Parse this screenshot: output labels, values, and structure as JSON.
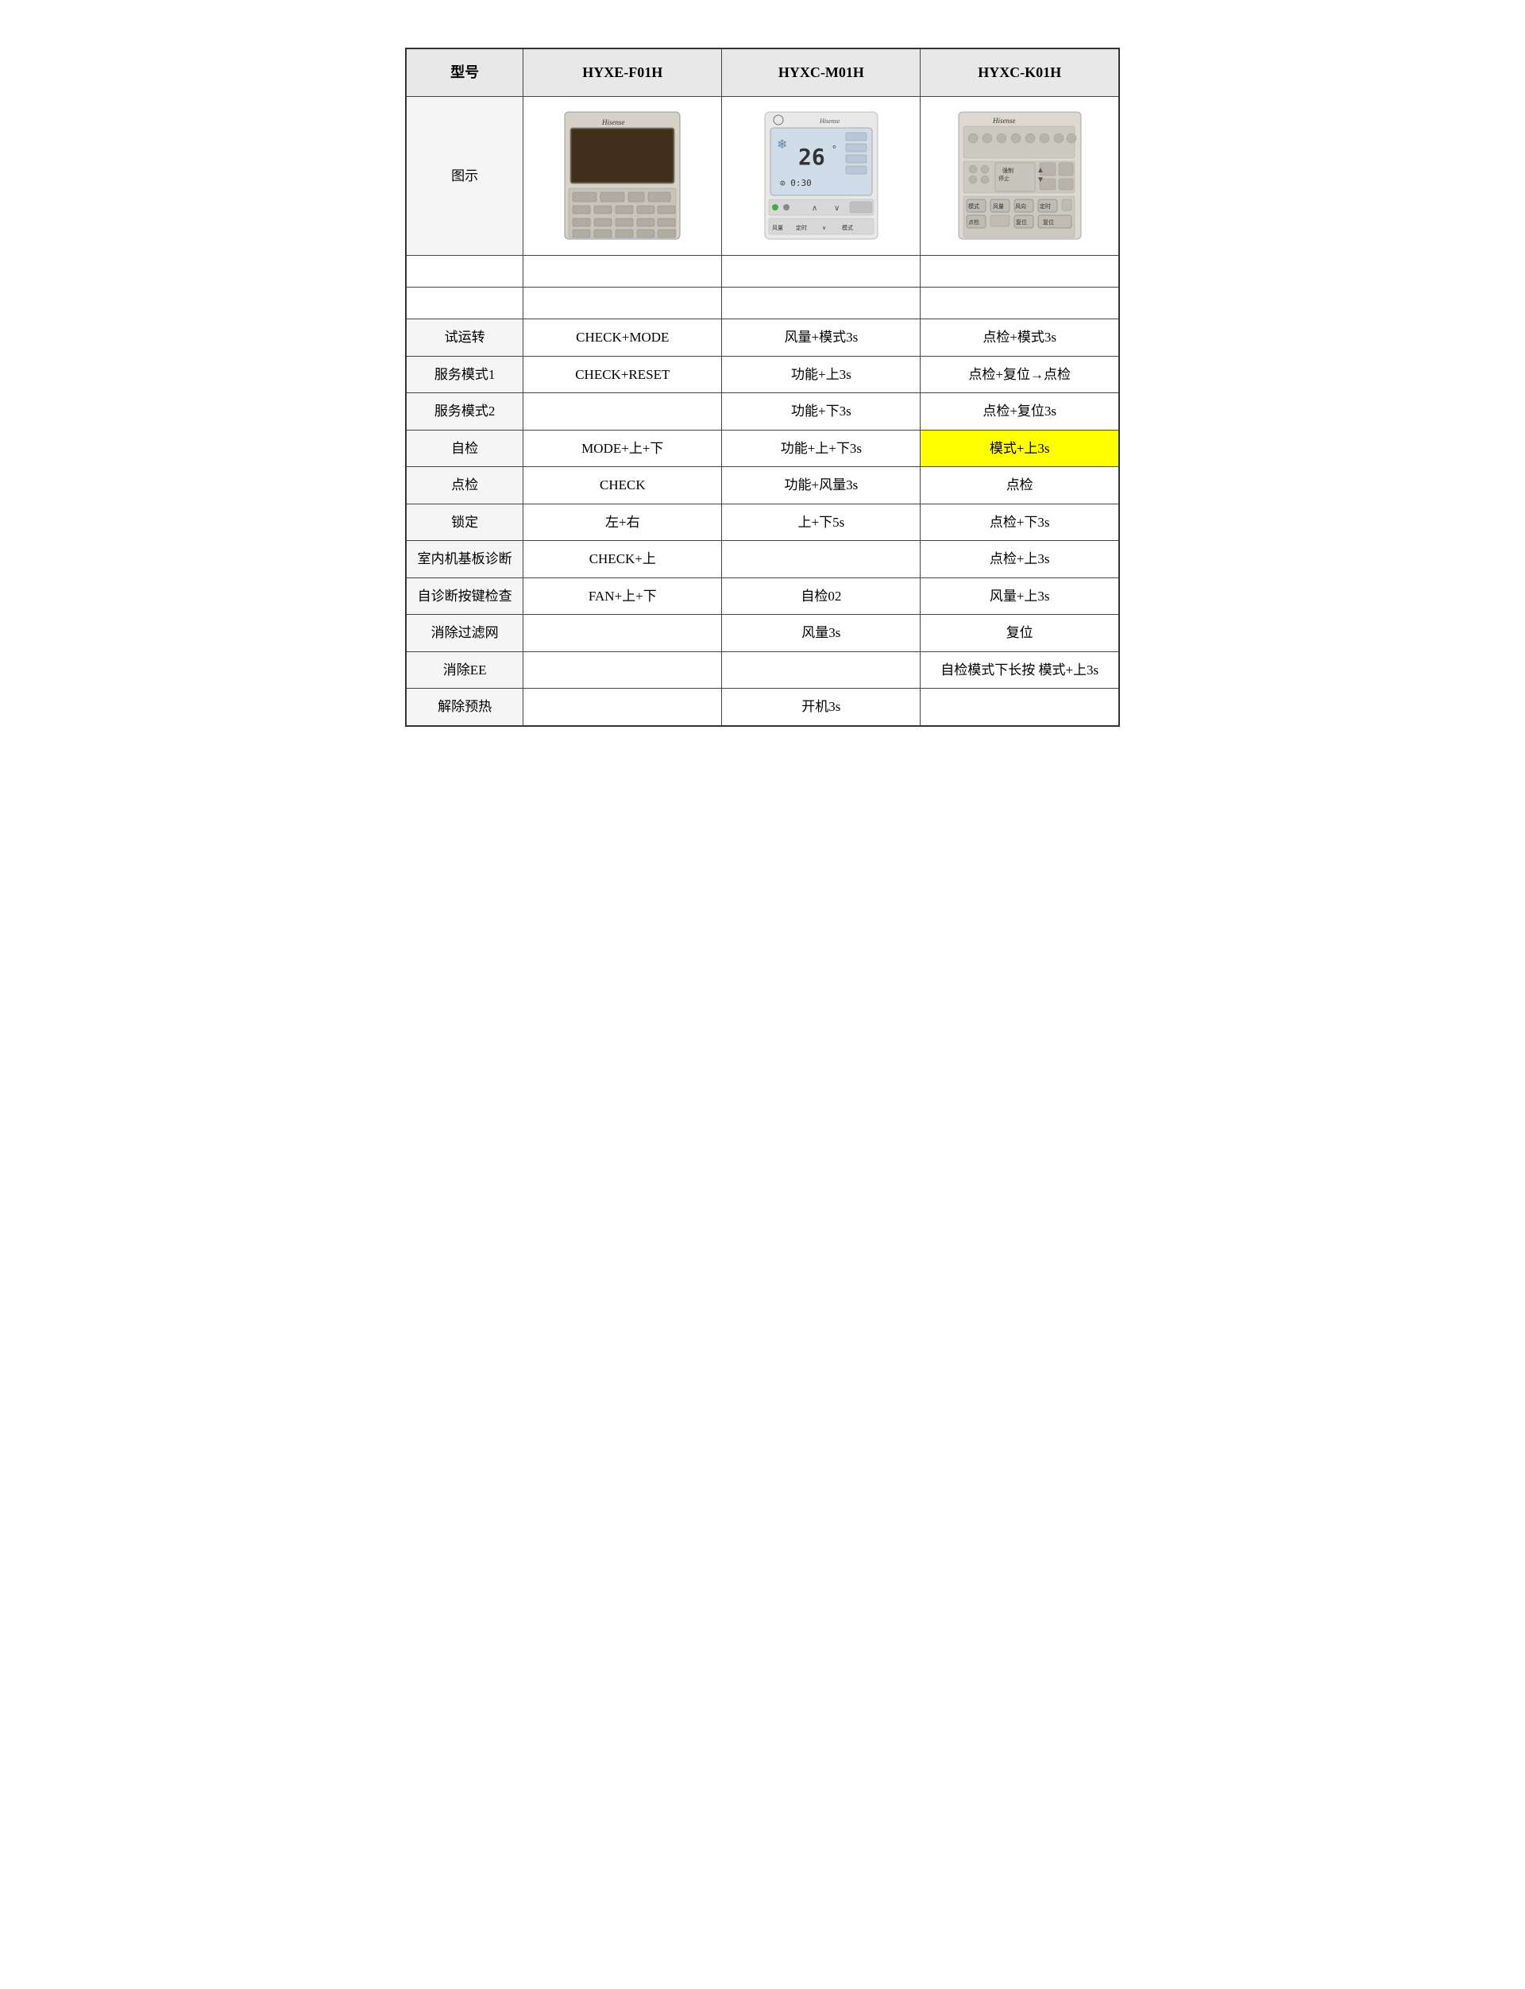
{
  "table": {
    "headers": [
      "型号",
      "HYXE-F01H",
      "HYXC-M01H",
      "HYXC-K01H"
    ],
    "image_row_label": "图示",
    "rows": [
      {
        "label": "",
        "f01h": "",
        "m01h": "",
        "k01h": "",
        "empty": true
      },
      {
        "label": "试运转",
        "f01h": "CHECK+MODE",
        "m01h": "风量+模式3s",
        "k01h": "点检+模式3s"
      },
      {
        "label": "服务模式1",
        "f01h": "CHECK+RESET",
        "m01h": "功能+上3s",
        "k01h": "点检+复位→点检"
      },
      {
        "label": "服务模式2",
        "f01h": "",
        "m01h": "功能+下3s",
        "k01h": "点检+复位3s"
      },
      {
        "label": "自检",
        "f01h": "MODE+上+下",
        "m01h": "功能+上+下3s",
        "k01h": "模式+上3s",
        "k01h_highlight": true
      },
      {
        "label": "点检",
        "f01h": "CHECK",
        "m01h": "功能+风量3s",
        "k01h": "点检"
      },
      {
        "label": "锁定",
        "f01h": "左+右",
        "m01h": "上+下5s",
        "k01h": "点检+下3s"
      },
      {
        "label": "室内机基板诊断",
        "f01h": "CHECK+上",
        "m01h": "",
        "k01h": "点检+上3s"
      },
      {
        "label": "自诊断按键检查",
        "f01h": "FAN+上+下",
        "m01h": "自检02",
        "k01h": "风量+上3s"
      },
      {
        "label": "消除过滤网",
        "f01h": "",
        "m01h": "风量3s",
        "k01h": "复位"
      },
      {
        "label": "消除EE",
        "f01h": "",
        "m01h": "",
        "k01h": "自检模式下长按 模式+上3s"
      },
      {
        "label": "解除预热",
        "f01h": "",
        "m01h": "开机3s",
        "k01h": ""
      }
    ]
  }
}
